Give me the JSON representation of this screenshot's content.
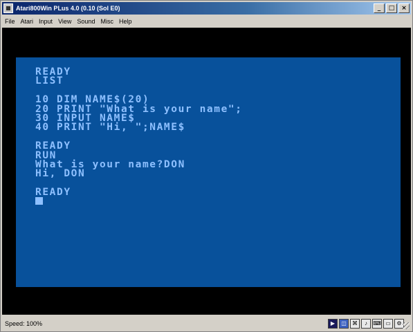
{
  "window": {
    "title": "Atari800Win PLus 4.0 (0.10 (Sol E0)",
    "buttons": {
      "minimize": "_",
      "maximize": "□",
      "close": "×"
    }
  },
  "menu": {
    "items": [
      {
        "label": "File"
      },
      {
        "label": "Atari"
      },
      {
        "label": "Input"
      },
      {
        "label": "View"
      },
      {
        "label": "Sound"
      },
      {
        "label": "Misc"
      },
      {
        "label": "Help"
      }
    ]
  },
  "screen": {
    "background_color": "#08519b",
    "text_color": "#8ec0ff",
    "lines": [
      "READY",
      "LIST",
      "",
      "10 DIM NAME$(20)",
      "20 PRINT \"What is your name\";",
      "30 INPUT NAME$",
      "40 PRINT \"Hi, \";NAME$",
      "",
      "READY",
      "RUN",
      "What is your name?DON",
      "Hi, DON",
      "",
      "READY"
    ]
  },
  "status": {
    "speed_text": "Speed: 100%",
    "icons": [
      {
        "name": "play-icon",
        "glyph": "▶"
      },
      {
        "name": "disk-icon",
        "glyph": "◫"
      },
      {
        "name": "joystick-icon",
        "glyph": "⌘"
      },
      {
        "name": "sound-icon",
        "glyph": "♪"
      },
      {
        "name": "keyboard-icon",
        "glyph": "⌨"
      },
      {
        "name": "monitor-icon",
        "glyph": "▭"
      },
      {
        "name": "settings-icon",
        "glyph": "⚙"
      }
    ]
  }
}
